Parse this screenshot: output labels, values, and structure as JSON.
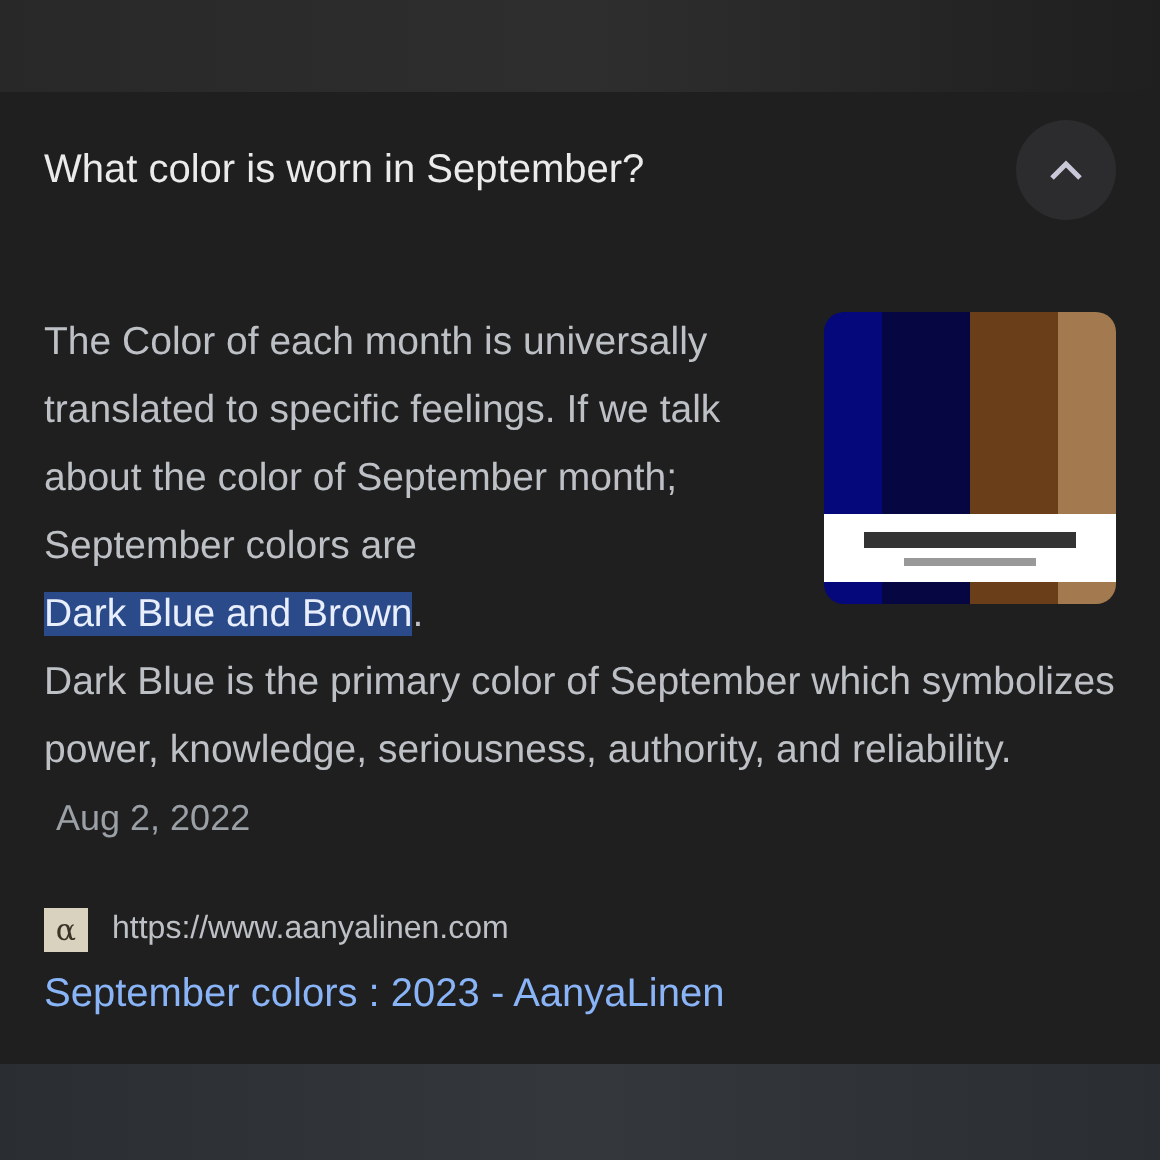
{
  "question": {
    "title": "What color is worn in September?",
    "expanded": true
  },
  "answer": {
    "lead": "The Color of each month is universally translated to specific feelings. If we talk about the color of September month; September colors are ",
    "highlight": "Dark Blue and Brown",
    "tail": ".",
    "detail": "Dark Blue is the primary color of September which symbolizes power, knowledge, seriousness, authority, and reliability.",
    "date": "Aug 2, 2022"
  },
  "source": {
    "favicon_glyph": "α",
    "url": "https://www.aanyalinen.com",
    "title": "September colors : 2023 - AanyaLinen"
  }
}
